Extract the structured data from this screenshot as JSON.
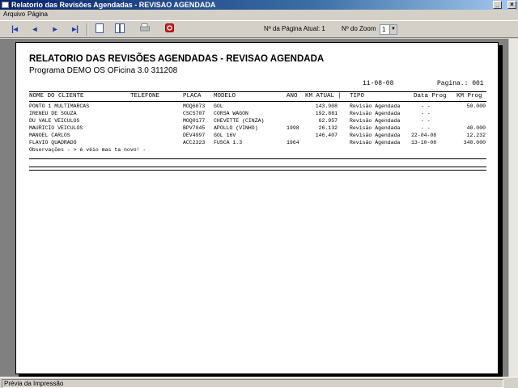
{
  "window": {
    "title": "Relatorio das Revisões Agendadas - REVISAO AGENDADA"
  },
  "menu": {
    "items": [
      "Arquivo",
      "Página"
    ]
  },
  "toolbar": {
    "page_label": "Nº da Página Atual: 1",
    "zoom_label": "Nº do Zoom",
    "zoom_value": "1"
  },
  "report": {
    "title": "RELATORIO DAS REVISÕES AGENDADAS - REVISAO AGENDADA",
    "subtitle": "Programa DEMO OS OFicina 3.0 311208",
    "date": "11-08-08",
    "page": "Pagina.: 001",
    "columns": [
      "NOME DO CLIENTE",
      "TELEFONE",
      "PLACA",
      "MODELO",
      "ANO",
      "KM ATUAL |",
      "TIPO",
      "Data Prog",
      "KM Prog"
    ],
    "rows": [
      [
        "PONTO 1 MULTIMARCAS",
        "",
        "MOQ6073",
        "GOL",
        "",
        "143.908",
        "Revisão Agendada",
        "-  -",
        "50.000"
      ],
      [
        "IRENEU DE SOUZA",
        "",
        "CSC5707",
        "CORSA  WAGON",
        "",
        "192.881",
        "Revisão Agendada",
        "-  -",
        ""
      ],
      [
        "DU VALE VEICULOS",
        "",
        "MOQ0177",
        "CHEVETTE  (CINZA)",
        "",
        "62.957",
        "Revisão Agendada",
        "-  -",
        ""
      ],
      [
        "MAURICIO VEICULOS",
        "",
        "BPV7045",
        "APOLLO  (VINHO)",
        "1998",
        "26.132",
        "Revisão Agendada",
        "-  -",
        "40.000"
      ],
      [
        "MANOEL CARLOS",
        "",
        "DEV4997",
        "GOL 16V",
        "",
        "146.407",
        "Revisão Agendada",
        "22-04-08",
        "12.232"
      ],
      [
        "FLAVIO QUADRADO",
        "",
        "ACC2323",
        "FUSCA 1.3",
        "1964",
        "",
        "Revisão Agendada",
        "13-10-08",
        "340.000"
      ]
    ],
    "note": "Observações - > é véio mas ta novo! -"
  },
  "status": {
    "text": "Prévia da Impressão"
  }
}
